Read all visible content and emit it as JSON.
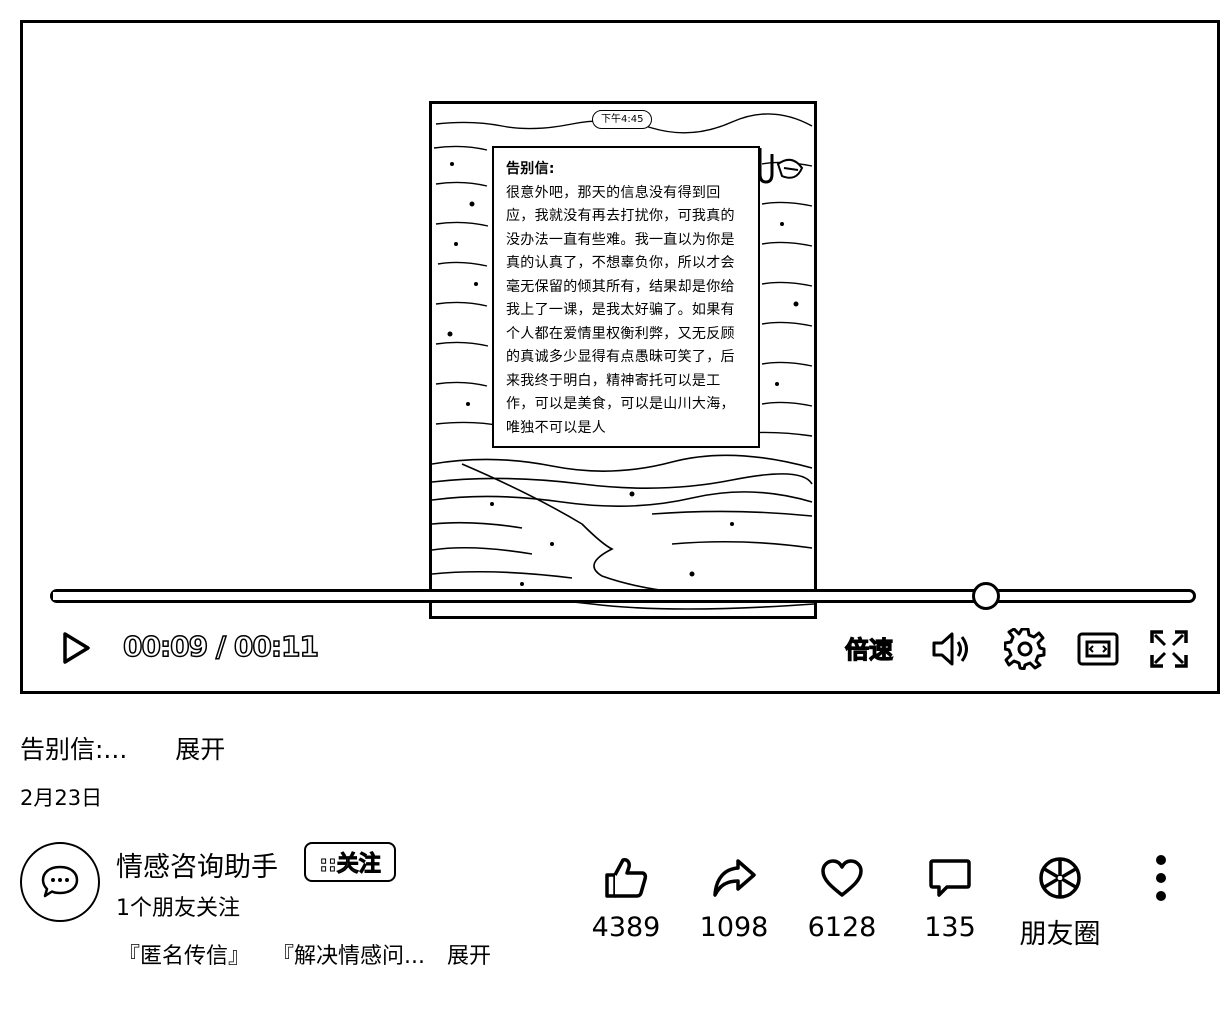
{
  "video": {
    "phone_time": "下午4:45",
    "letter_title": "告别信:",
    "letter_body": "很意外吧，那天的信息没有得到回应，我就没有再去打扰你，可我真的没办法一直有些难。我一直以为你是真的认真了，不想辜负你，所以才会毫无保留的倾其所有，结果却是你给我上了一课，是我太好骗了。如果有个人都在爱情里权衡利弊，又无反顾的真诚多少显得有点愚昧可笑了，后来我终于明白，精神寄托可以是工作，可以是美食，可以是山川大海，唯独不可以是人",
    "progress": 0.818
  },
  "controls": {
    "time_current": "00:09",
    "time_separator": " / ",
    "time_total": "00:11",
    "speed_label": "倍速"
  },
  "post": {
    "title": "告别信:...",
    "expand": "展开",
    "date": "2月23日"
  },
  "author": {
    "name": "情感咨询助手",
    "follow_label": "::关注",
    "followers": "1个朋友关注",
    "tag1": "『匿名传信』",
    "tag2": "『解决情感问...",
    "tags_expand": "展开"
  },
  "actions": {
    "like_count": "4389",
    "share_count": "1098",
    "favorite_count": "6128",
    "comment_count": "135",
    "moments_label": "朋友圈"
  }
}
